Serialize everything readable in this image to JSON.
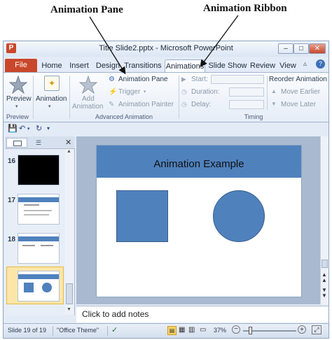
{
  "annotations": {
    "animation_pane": "Animation Pane",
    "animation_ribbon": "Animation Ribbon"
  },
  "window": {
    "title": "Title Slide2.pptx - Microsoft PowerPoint",
    "app_icon": "P",
    "minimize": "–",
    "maximize": "□",
    "close": "✕"
  },
  "tabs": [
    "File",
    "Home",
    "Insert",
    "Design",
    "Transitions",
    "Animations",
    "Slide Show",
    "Review",
    "View"
  ],
  "ribbon": {
    "preview": {
      "button": "Preview",
      "group": "Preview"
    },
    "animation": {
      "button": "Animation"
    },
    "advanced": {
      "add_animation_line1": "Add",
      "add_animation_line2": "Animation",
      "animation_pane": "Animation Pane",
      "trigger": "Trigger",
      "animation_painter": "Animation Painter",
      "group": "Advanced Animation"
    },
    "timing": {
      "start": "Start:",
      "duration": "Duration:",
      "delay": "Delay:",
      "group": "Timing"
    },
    "reorder": {
      "title": "Reorder Animation",
      "move_earlier": "Move Earlier",
      "move_later": "Move Later"
    }
  },
  "slides_panel": {
    "thumbnails": [
      {
        "number": "16"
      },
      {
        "number": "17"
      },
      {
        "number": "18"
      },
      {
        "number": "19",
        "selected": true
      }
    ],
    "thumb_19_title": "Animation Example"
  },
  "slide": {
    "title": "Animation Example",
    "accent_color": "#4f81bd"
  },
  "notes": {
    "placeholder": "Click to add notes"
  },
  "status": {
    "slide_info": "Slide 19 of 19",
    "theme": "\"Office Theme\"",
    "zoom": "37%"
  }
}
